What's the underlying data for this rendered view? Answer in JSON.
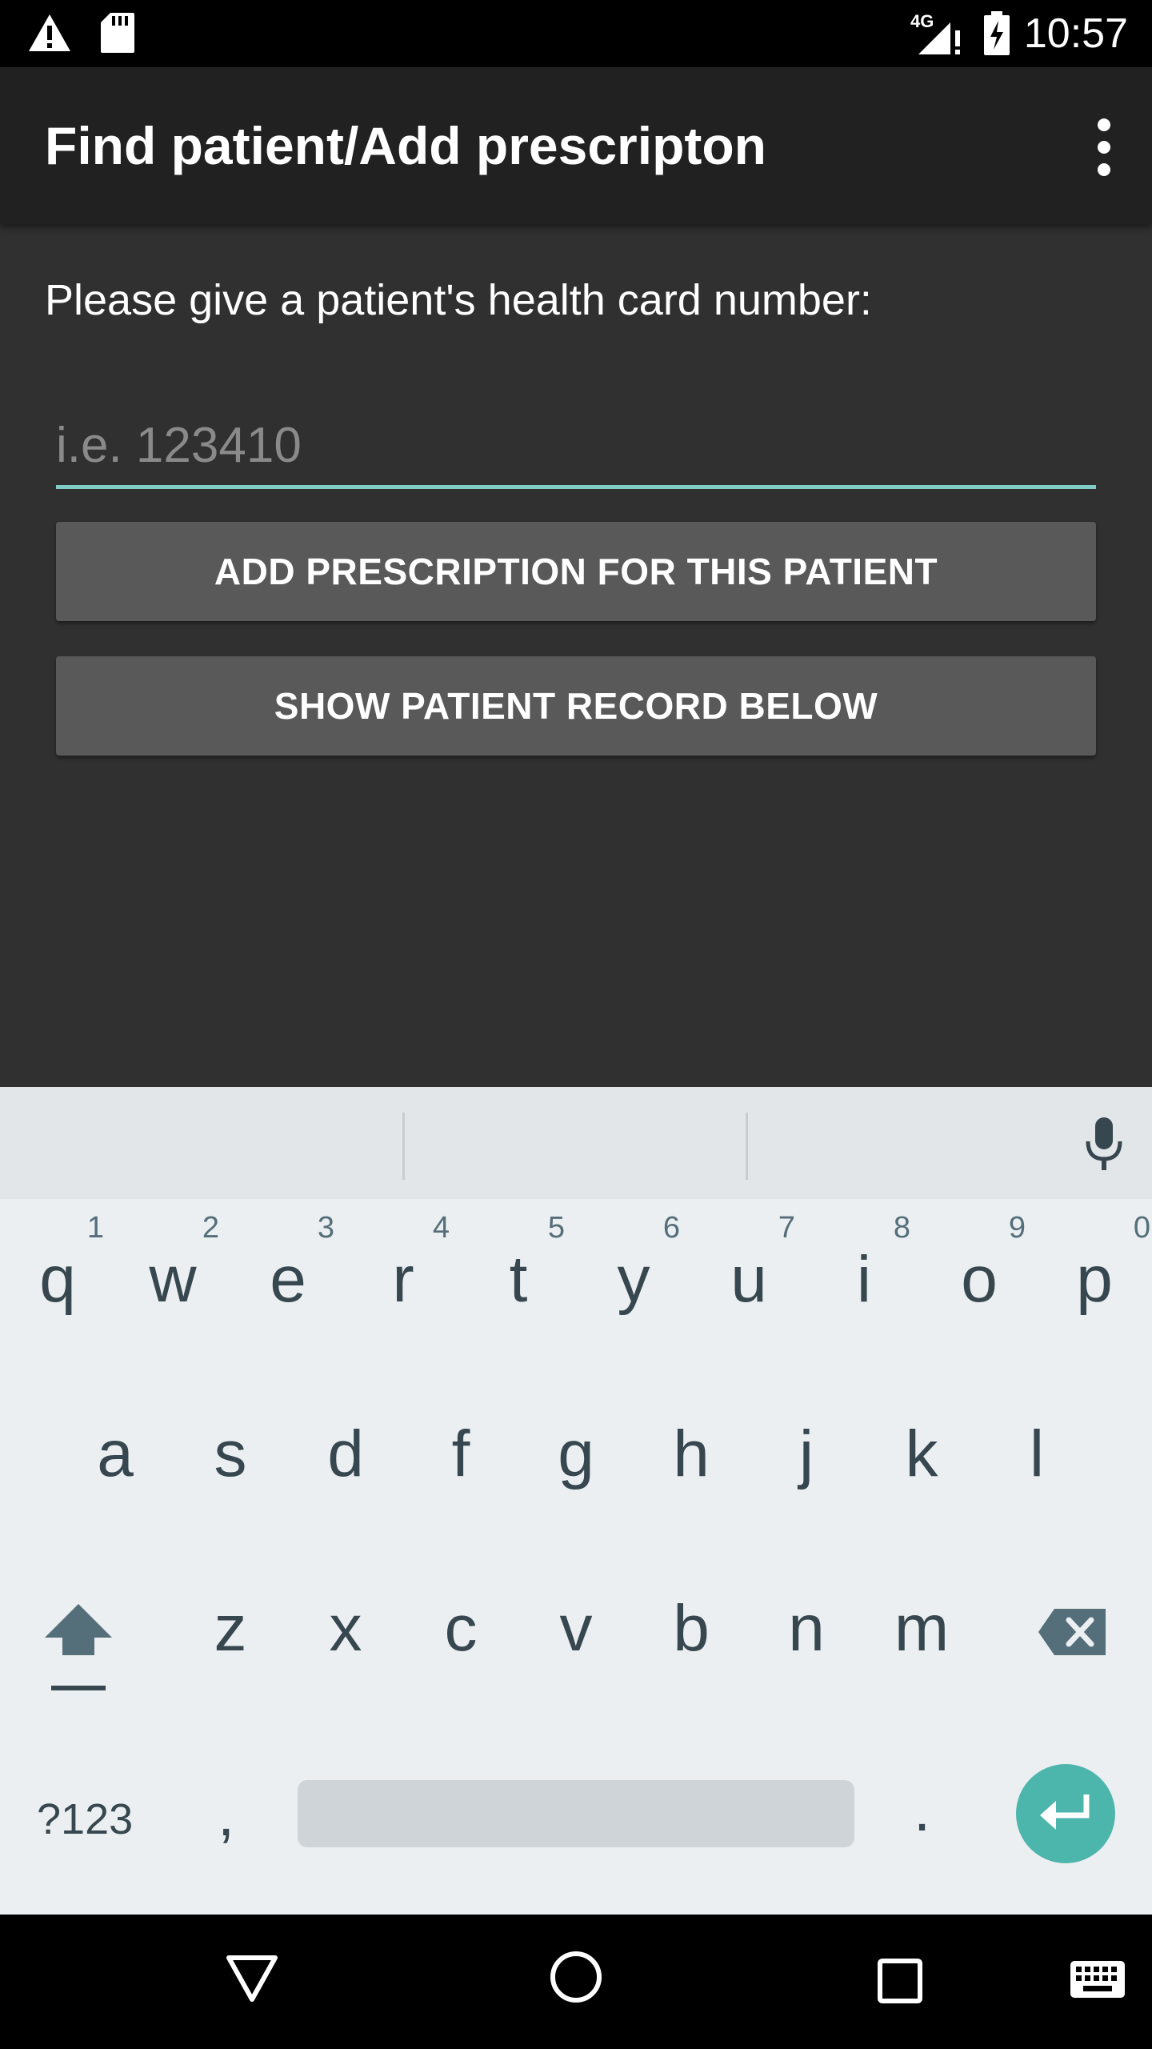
{
  "status_bar": {
    "network": "4G",
    "time": "10:57"
  },
  "app_bar": {
    "title": "Find patient/Add prescripton"
  },
  "form": {
    "prompt": "Please give a patient's health card number:",
    "card_number_value": "",
    "card_number_placeholder": "i.e. 123410",
    "add_button_label": "ADD PRESCRIPTION FOR THIS PATIENT",
    "show_button_label": "SHOW PATIENT RECORD BELOW"
  },
  "keyboard": {
    "row1": [
      {
        "key": "q",
        "hint": "1"
      },
      {
        "key": "w",
        "hint": "2"
      },
      {
        "key": "e",
        "hint": "3"
      },
      {
        "key": "r",
        "hint": "4"
      },
      {
        "key": "t",
        "hint": "5"
      },
      {
        "key": "y",
        "hint": "6"
      },
      {
        "key": "u",
        "hint": "7"
      },
      {
        "key": "i",
        "hint": "8"
      },
      {
        "key": "o",
        "hint": "9"
      },
      {
        "key": "p",
        "hint": "0"
      }
    ],
    "row2": [
      "a",
      "s",
      "d",
      "f",
      "g",
      "h",
      "j",
      "k",
      "l"
    ],
    "row3": [
      "z",
      "x",
      "c",
      "v",
      "b",
      "n",
      "m"
    ],
    "symbols_label": "?123",
    "comma_label": ",",
    "period_label": ".",
    "accent_color": "#4DB6AC"
  },
  "colors": {
    "background": "#303030",
    "app_bar": "#212121",
    "button": "#595959",
    "input_underline": "#80CBC4"
  }
}
